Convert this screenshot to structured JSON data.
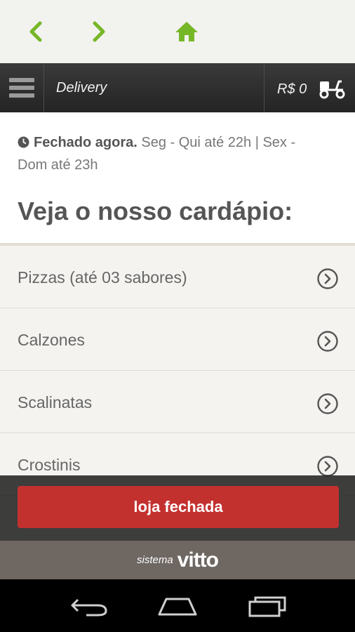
{
  "browser": {
    "back_icon": "chevron-left-icon",
    "forward_icon": "chevron-right-icon",
    "home_icon": "home-icon",
    "accent": "#76b728"
  },
  "header": {
    "menu_icon": "hamburger-menu-icon",
    "title": "Delivery",
    "cart_total": "R$ 0",
    "delivery_icon": "scooter-icon"
  },
  "store": {
    "status_icon": "clock-icon",
    "status": "Fechado agora.",
    "hours": " Seg - Qui até 22h | Sex - Dom até 23h"
  },
  "menu": {
    "heading": "Veja o nosso cardápio:",
    "items": [
      {
        "label": "Pizzas (até 03 sabores)"
      },
      {
        "label": "Calzones"
      },
      {
        "label": "Scalinatas"
      },
      {
        "label": "Crostinis"
      }
    ]
  },
  "footer": {
    "button_label": "loja fechada",
    "button_color": "#c3312f",
    "brand_prefix": "sistema",
    "brand_name": "vitto"
  },
  "system_nav": {
    "back_icon": "back-arrow-icon",
    "home_icon": "home-outline-icon",
    "recents_icon": "recent-apps-icon"
  }
}
